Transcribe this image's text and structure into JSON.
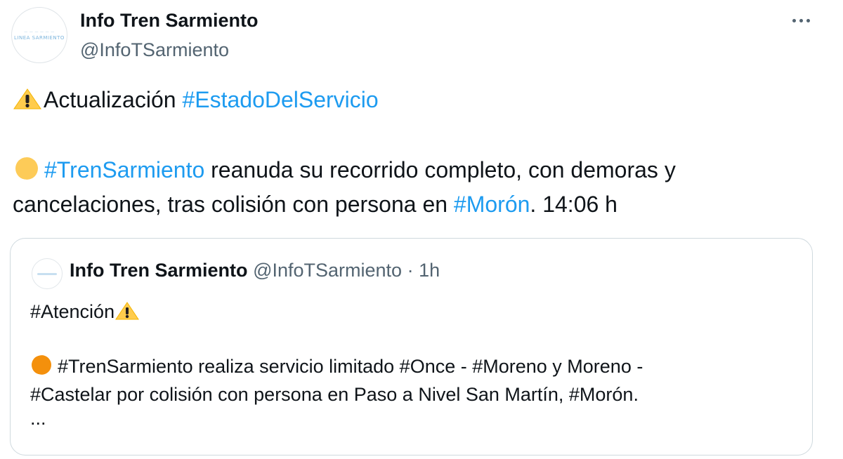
{
  "tweet": {
    "display_name": "Info Tren Sarmiento",
    "handle": "@InfoTSarmiento",
    "more_icon": "more-horizontal-icon",
    "avatar_text": [
      "LINEA SARMIENTO"
    ],
    "line1": {
      "icon": "warning-icon",
      "text": "Actualización ",
      "hashtag": "#EstadoDelServicio"
    },
    "line2": {
      "icon": "yellow-circle-icon",
      "hashtag1": "#TrenSarmiento",
      "text1": " reanuda su recorrido completo, con demoras y",
      "text2": "cancelaciones, tras colisión con persona en ",
      "hashtag2": "#Morón",
      "text3": ". 14:06 h"
    }
  },
  "quote": {
    "display_name": "Info Tren Sarmiento",
    "handle": "@InfoTSarmiento",
    "dot": " · ",
    "time": "1h",
    "line1": {
      "text": "#Atención",
      "icon": "warning-icon"
    },
    "line2": {
      "icon": "orange-circle-icon",
      "text": "#TrenSarmiento realiza servicio limitado #Once - #Moreno y Moreno -"
    },
    "line3": {
      "text": "#Castelar por colisión con persona en Paso a Nivel San Martín, #Morón."
    },
    "line4": {
      "text": "..."
    }
  },
  "colors": {
    "hashtag": "#1d9bf0",
    "secondary_text": "#536471",
    "border": "#cfd9de",
    "yellow_circle": "#fdcb58",
    "orange_circle": "#f4900c",
    "warning_yellow": "#ffcc4d"
  }
}
